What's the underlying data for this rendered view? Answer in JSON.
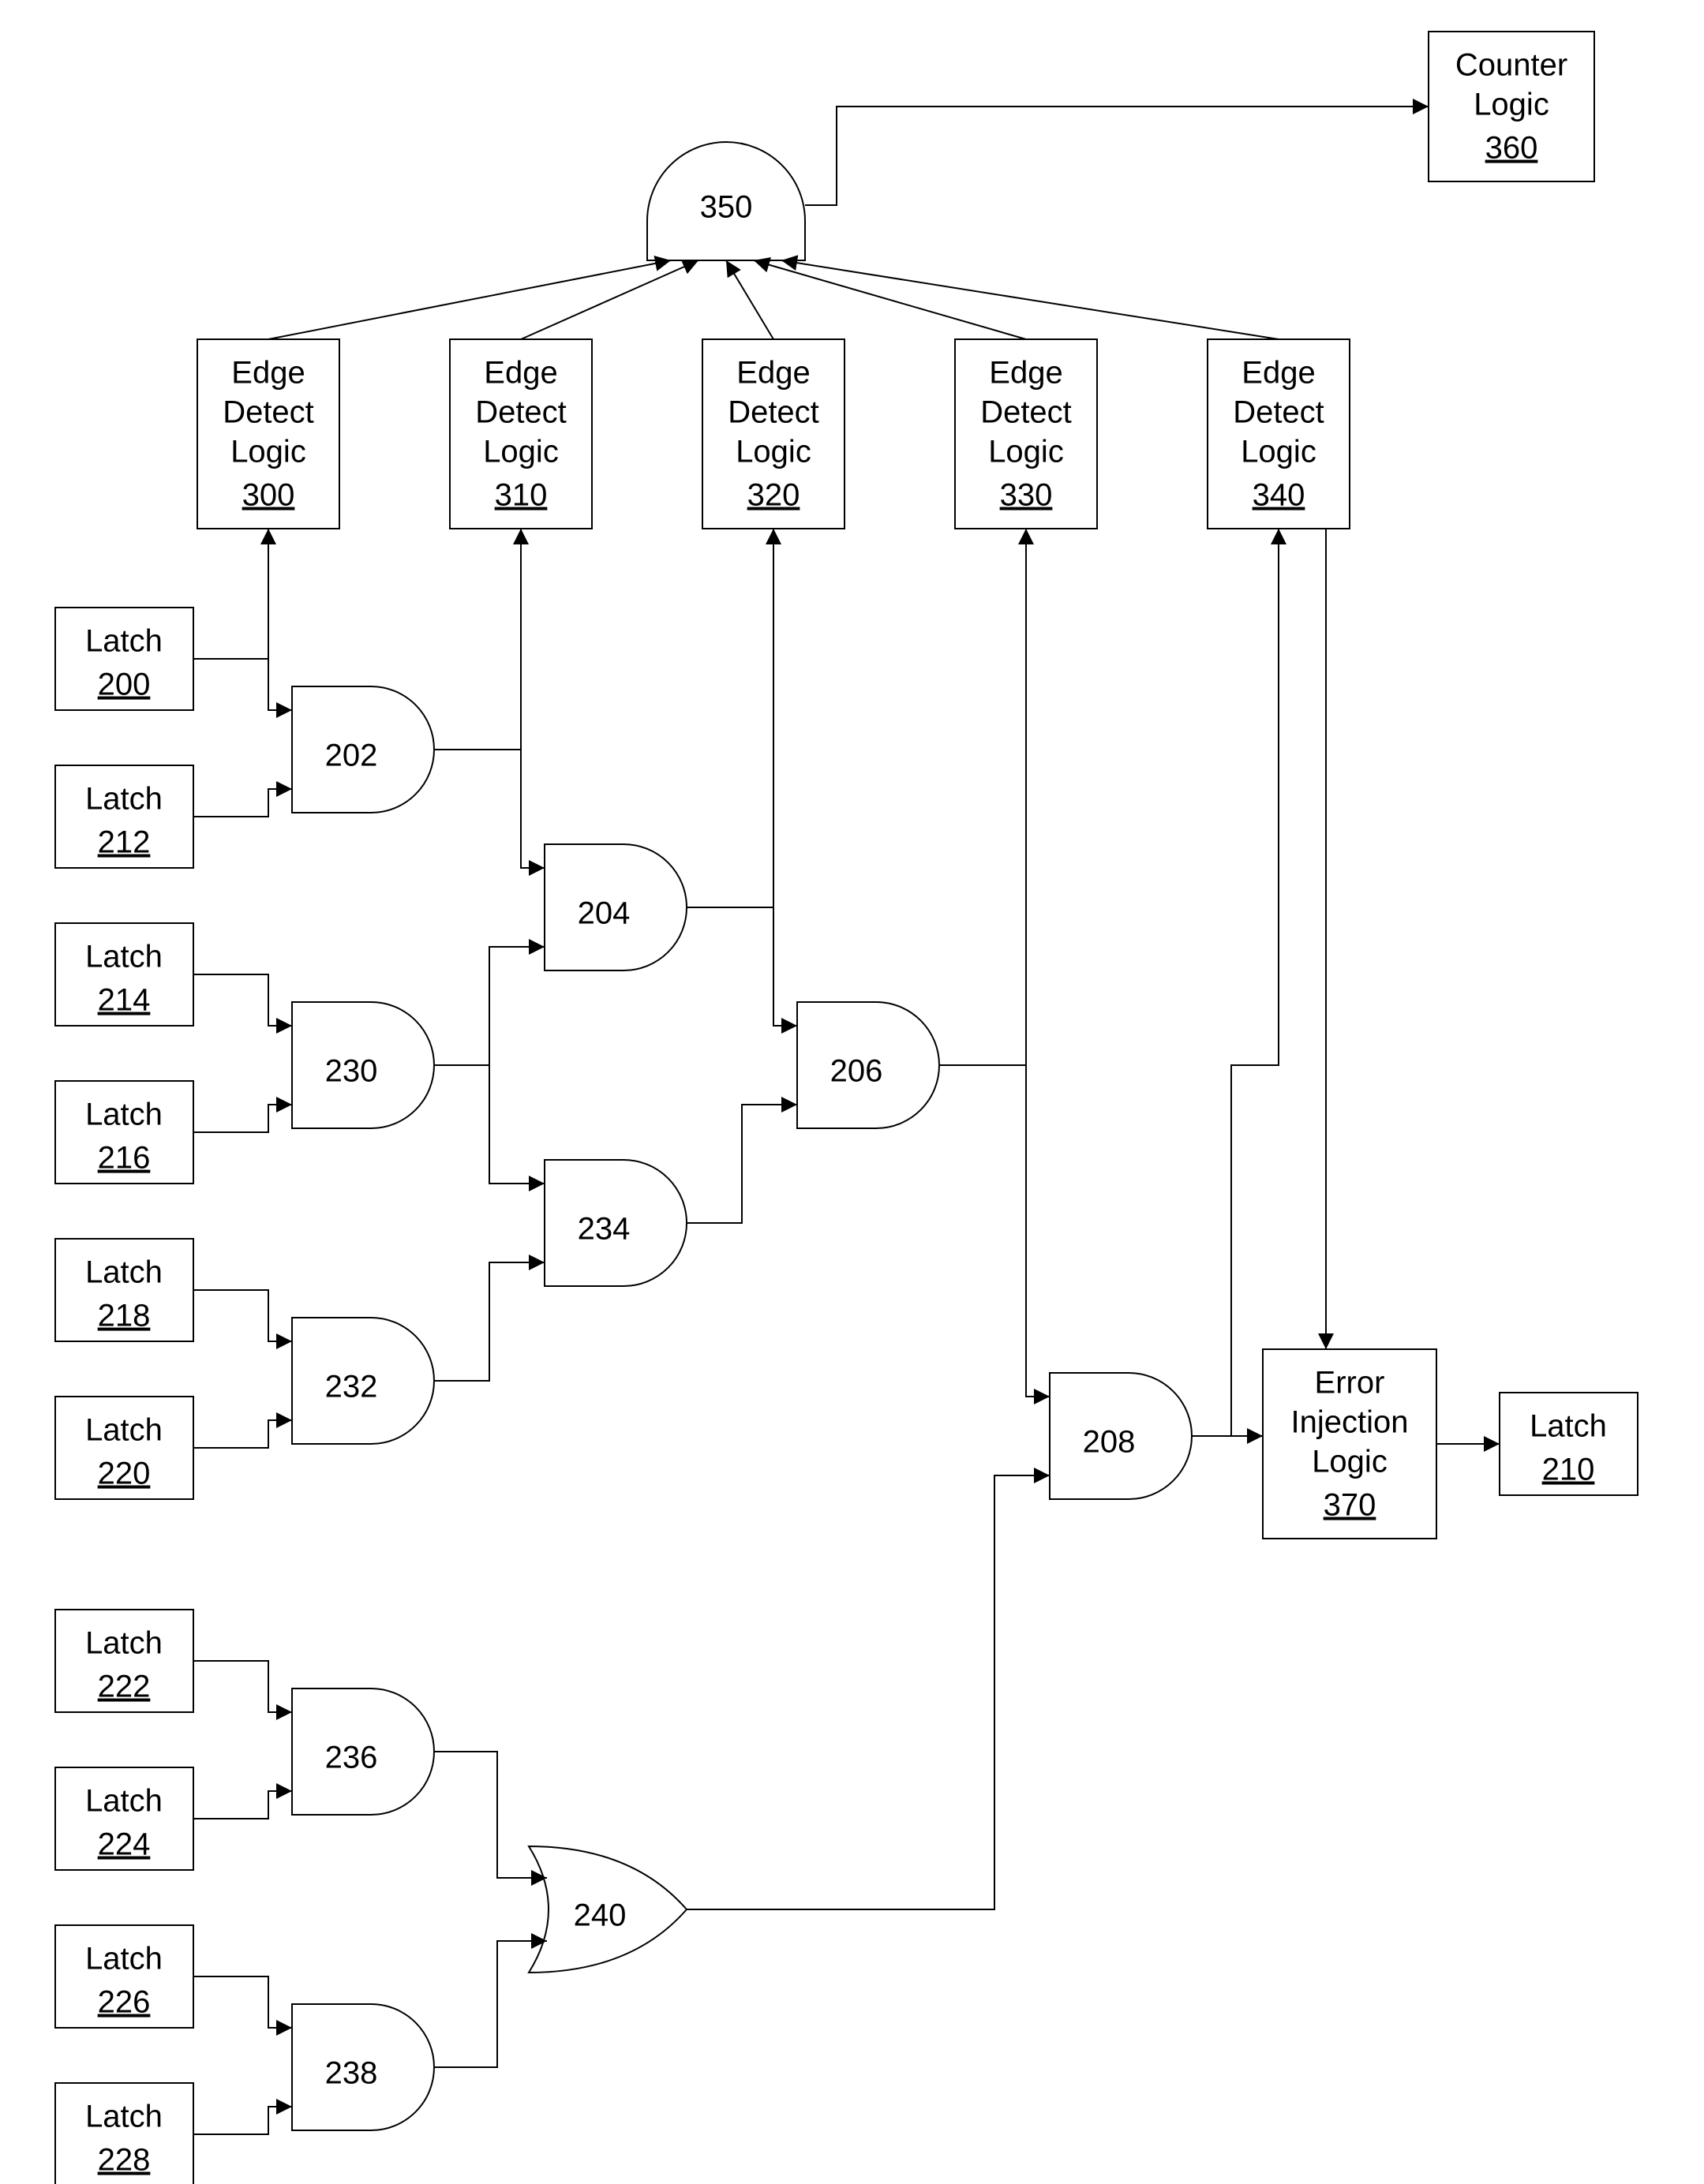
{
  "latches": {
    "l200": {
      "label": "Latch",
      "num": "200"
    },
    "l212": {
      "label": "Latch",
      "num": "212"
    },
    "l214": {
      "label": "Latch",
      "num": "214"
    },
    "l216": {
      "label": "Latch",
      "num": "216"
    },
    "l218": {
      "label": "Latch",
      "num": "218"
    },
    "l220": {
      "label": "Latch",
      "num": "220"
    },
    "l222": {
      "label": "Latch",
      "num": "222"
    },
    "l224": {
      "label": "Latch",
      "num": "224"
    },
    "l226": {
      "label": "Latch",
      "num": "226"
    },
    "l228": {
      "label": "Latch",
      "num": "228"
    },
    "l210": {
      "label": "Latch",
      "num": "210"
    }
  },
  "gates": {
    "g202": "202",
    "g204": "204",
    "g206": "206",
    "g208": "208",
    "g230": "230",
    "g232": "232",
    "g234": "234",
    "g236": "236",
    "g238": "238",
    "g240": "240",
    "g350": "350"
  },
  "edge_blocks": {
    "e300": {
      "l1": "Edge",
      "l2": "Detect",
      "l3": "Logic",
      "num": "300"
    },
    "e310": {
      "l1": "Edge",
      "l2": "Detect",
      "l3": "Logic",
      "num": "310"
    },
    "e320": {
      "l1": "Edge",
      "l2": "Detect",
      "l3": "Logic",
      "num": "320"
    },
    "e330": {
      "l1": "Edge",
      "l2": "Detect",
      "l3": "Logic",
      "num": "330"
    },
    "e340": {
      "l1": "Edge",
      "l2": "Detect",
      "l3": "Logic",
      "num": "340"
    }
  },
  "counter": {
    "l1": "Counter",
    "l2": "Logic",
    "num": "360"
  },
  "error_inj": {
    "l1": "Error",
    "l2": "Injection",
    "l3": "Logic",
    "num": "370"
  }
}
